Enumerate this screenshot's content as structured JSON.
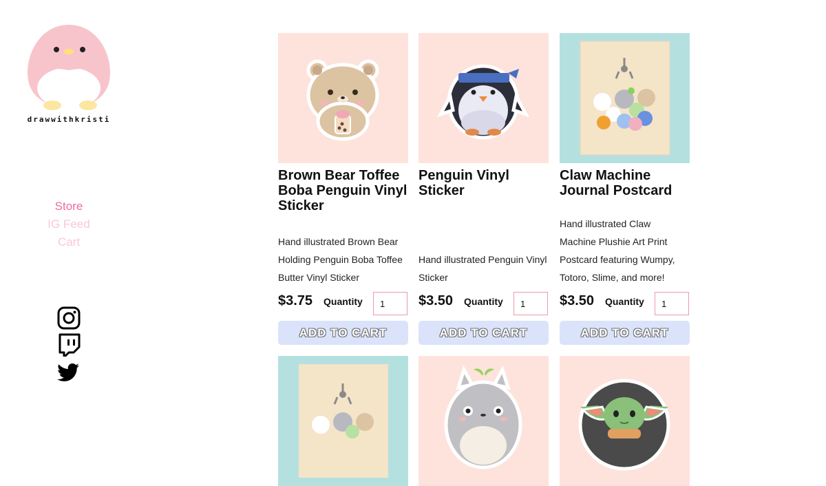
{
  "brand": {
    "logo_text": "drawwithkristi"
  },
  "nav": {
    "items": [
      {
        "label": "Store",
        "active": true
      },
      {
        "label": "IG Feed",
        "active": false
      },
      {
        "label": "Cart",
        "active": false
      }
    ]
  },
  "social": {
    "icons": [
      "instagram-icon",
      "twitch-icon",
      "twitter-icon"
    ]
  },
  "store": {
    "quantity_label": "Quantity",
    "add_to_cart_label": "ADD TO CART",
    "products": [
      {
        "title": "Brown Bear Toffee Boba Penguin Vinyl Sticker",
        "description": "Hand illustrated Brown Bear Holding Penguin Boba Toffee Butter Vinyl Sticker",
        "price": "$3.75",
        "quantity": "1",
        "bg": "#fde3dc"
      },
      {
        "title": "Penguin Vinyl Sticker",
        "description": "Hand illustrated Penguin Vinyl Sticker",
        "price": "$3.50",
        "quantity": "1",
        "bg": "#fde3dc"
      },
      {
        "title": "Claw Machine Journal Postcard",
        "description": "Hand illustrated Claw Machine Plushie Art Print Postcard featuring Wumpy, Totoro, Slime, and more!",
        "price": "$3.50",
        "quantity": "1",
        "bg": "#b5e0e0"
      },
      {
        "bg": "#b5e0e0"
      },
      {
        "bg": "#fde3dc"
      },
      {
        "bg": "#fde3dc"
      }
    ]
  },
  "colors": {
    "nav_active": "#f06aa2",
    "nav_inactive": "#f9c6db",
    "button_bg": "#dbe3fb",
    "input_border": "#e89aa8"
  }
}
